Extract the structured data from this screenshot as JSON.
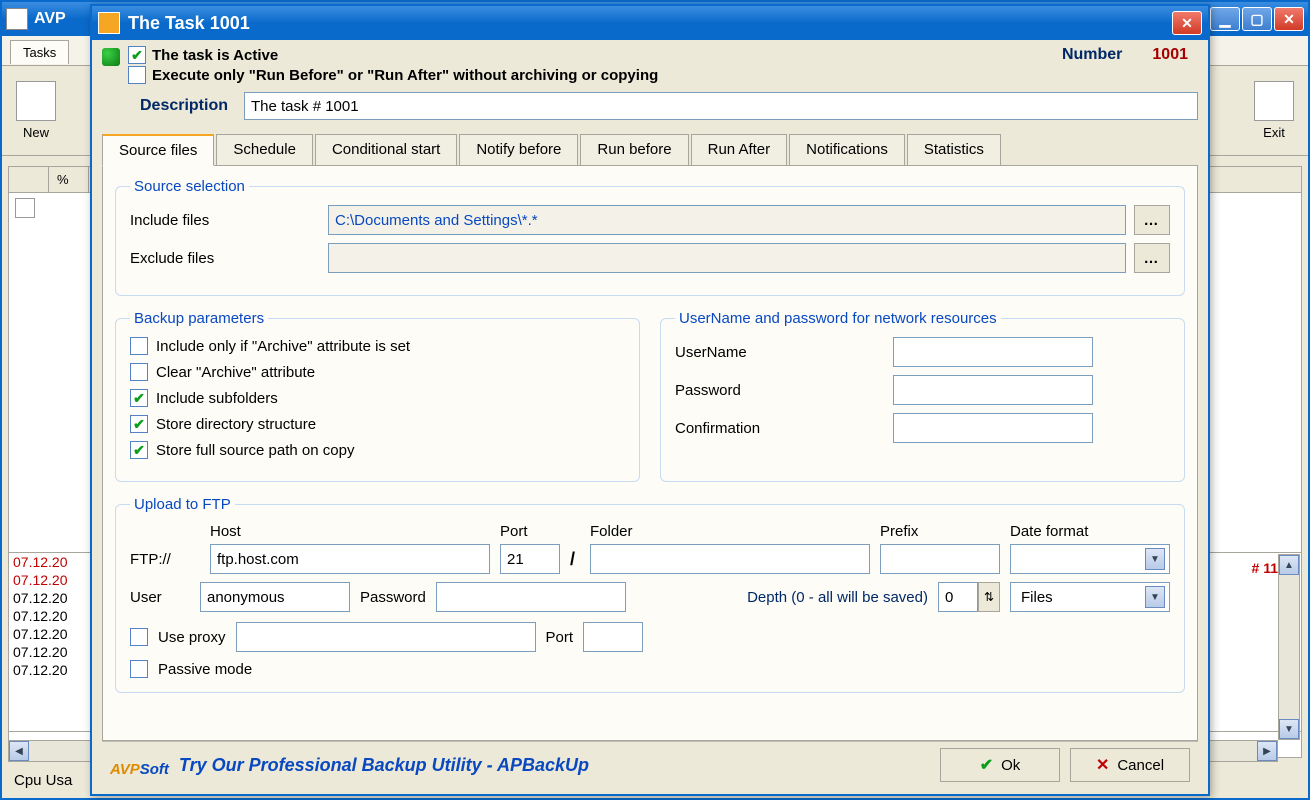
{
  "bg": {
    "title": "AVP",
    "tab": "Tasks",
    "toolbar": {
      "new": "New",
      "exit": "Exit"
    },
    "list_head_pct": "%",
    "hash": "# 11",
    "log": [
      {
        "t": "07.12.20",
        "red": true
      },
      {
        "t": "07.12.20",
        "red": true
      },
      {
        "t": "07.12.20",
        "red": false
      },
      {
        "t": "07.12.20",
        "red": false
      },
      {
        "t": "07.12.20",
        "red": false
      },
      {
        "t": "07.12.20",
        "red": false
      },
      {
        "t": "07.12.20",
        "red": false
      }
    ],
    "status": "Cpu Usa"
  },
  "dialog": {
    "title": "The Task 1001",
    "active_label": "The task is Active",
    "execute_only_label": "Execute only \"Run Before\" or \"Run After\" without archiving or copying",
    "number_label": "Number",
    "number_value": "1001",
    "description_label": "Description",
    "description_value": "The task # 1001",
    "tabs": [
      "Source files",
      "Schedule",
      "Conditional start",
      "Notify before",
      "Run before",
      "Run After",
      "Notifications",
      "Statistics"
    ],
    "source_selection": {
      "legend": "Source selection",
      "include_label": "Include files",
      "include_value": "C:\\Documents and Settings\\*.*",
      "exclude_label": "Exclude files",
      "exclude_value": ""
    },
    "backup_params": {
      "legend": "Backup parameters",
      "opt1": "Include only if \"Archive\" attribute is set",
      "opt2": "Clear \"Archive\" attribute",
      "opt3": "Include subfolders",
      "opt4": "Store directory structure",
      "opt5": "Store full source path on copy"
    },
    "net_auth": {
      "legend": "UserName and password for network resources",
      "user_label": "UserName",
      "pass_label": "Password",
      "conf_label": "Confirmation"
    },
    "ftp": {
      "legend": "Upload to FTP",
      "host_label": "Host",
      "port_label": "Port",
      "folder_label": "Folder",
      "prefix_label": "Prefix",
      "datefmt_label": "Date format",
      "ftp_prefix": "FTP://",
      "host_value": "ftp.host.com",
      "port_value": "21",
      "folder_value": "",
      "prefix_value": "",
      "user_label": "User",
      "user_value": "anonymous",
      "password_label": "Password",
      "password_value": "",
      "depth_label": "Depth (0 - all will be saved)",
      "depth_value": "0",
      "files_combo": "Files",
      "use_proxy_label": "Use proxy",
      "proxy_port_label": "Port",
      "passive_label": "Passive mode"
    },
    "footer": {
      "logo_a": "AVP",
      "logo_soft": "Soft",
      "promo": "Try Our Professional Backup Utility - APBackUp",
      "ok": "Ok",
      "cancel": "Cancel"
    }
  }
}
